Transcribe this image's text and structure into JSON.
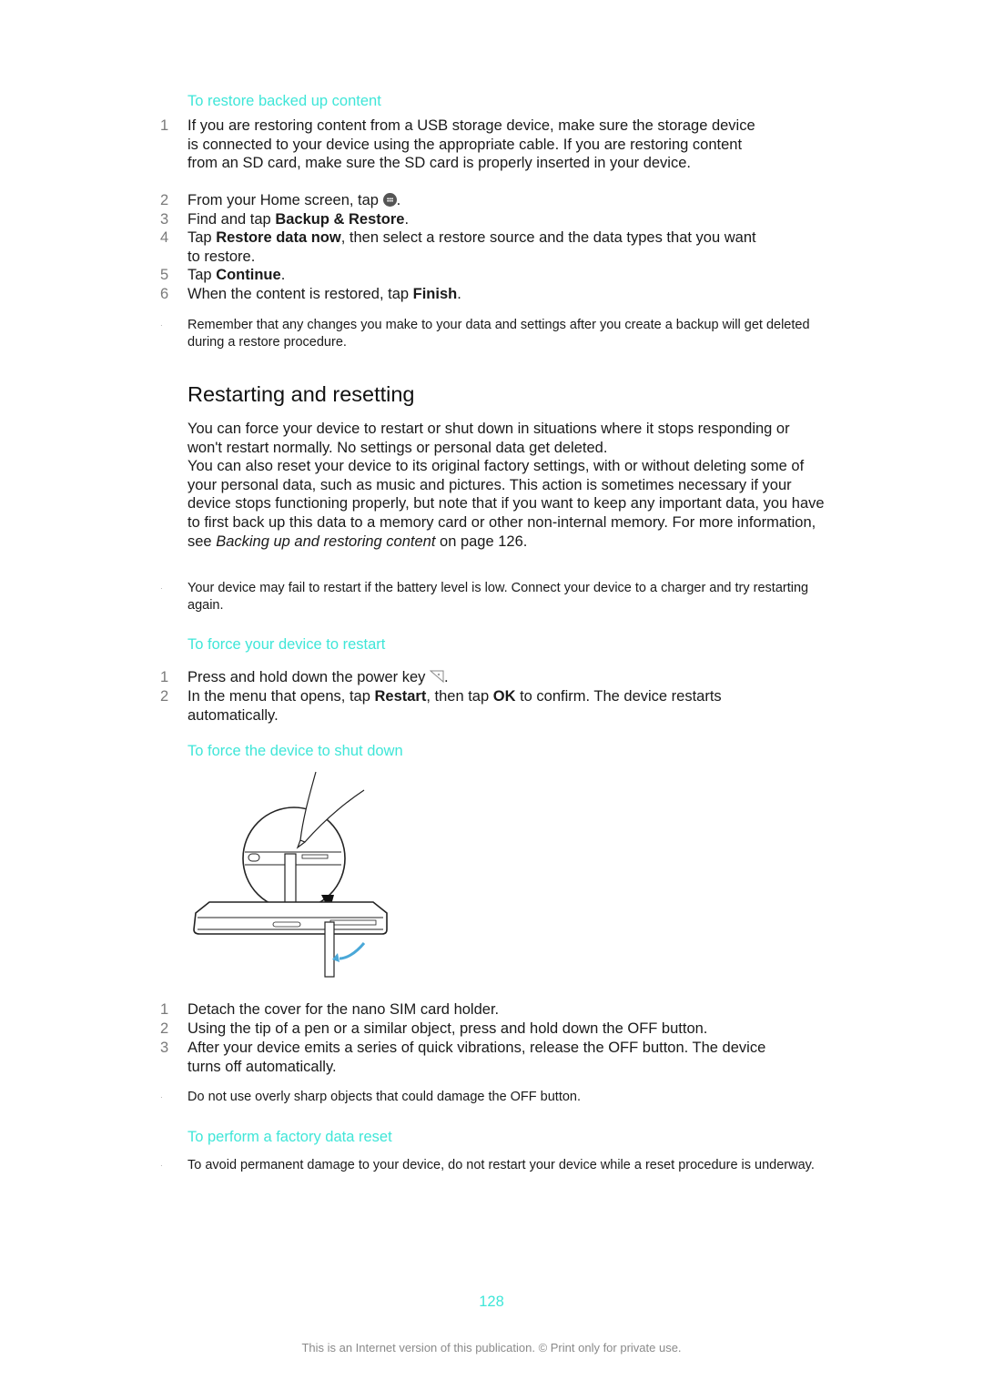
{
  "restore_section": {
    "heading": "To restore backed up content",
    "steps": [
      {
        "num": "1",
        "parts": [
          "If you are restoring content from a USB storage device, make sure the storage device is connected to your device using the appropriate cable. If you are restoring content from an SD card, make sure the SD card is properly inserted in your device."
        ]
      },
      {
        "num": "2",
        "before": "From your Home screen, tap ",
        "icon": "apps-icon",
        "after": "."
      },
      {
        "num": "3",
        "before": "Find and tap ",
        "bold": "Backup & Restore",
        "after": "."
      },
      {
        "num": "4",
        "before": "Tap ",
        "bold": "Restore data now",
        "after": ", then select a restore source and the data types that you want to restore."
      },
      {
        "num": "5",
        "before": "Tap ",
        "bold": "Continue",
        "after": "."
      },
      {
        "num": "6",
        "before": "When the content is restored, tap ",
        "bold": "Finish",
        "after": "."
      }
    ],
    "note": "Remember that any changes you make to your data and settings after you create a backup will get deleted during a restore procedure."
  },
  "restart_section": {
    "title": "Restarting and resetting",
    "para1": "You can force your device to restart or shut down in situations where it stops responding or won't restart normally. No settings or personal data get deleted.",
    "para2_before": "You can also reset your device to its original factory settings, with or without deleting some of your personal data, such as music and pictures. This action is sometimes necessary if your device stops functioning properly, but note that if you want to keep any important data, you have to first back up this data to a memory card or other non-internal memory. For more information, see ",
    "para2_link": "Backing up and restoring content",
    "para2_after": " on page 126.",
    "note": "Your device may fail to restart if the battery level is low. Connect your device to a charger and try restarting again."
  },
  "force_restart": {
    "heading": "To force your device to restart",
    "step1_num": "1",
    "step1_before": "Press and hold down the power key ",
    "step1_icon": "power-key-icon",
    "step1_after": ".",
    "step2_num": "2",
    "step2_before": "In the menu that opens, tap ",
    "step2_bold1": "Restart",
    "step2_mid": ", then tap ",
    "step2_bold2": "OK",
    "step2_after": " to confirm. The device restarts automatically."
  },
  "force_shutdown": {
    "heading": "To force the device to shut down",
    "figure_alt": "Pen tip pressing OFF button under SIM card holder cover",
    "steps": [
      {
        "num": "1",
        "text": "Detach the cover for the nano SIM card holder."
      },
      {
        "num": "2",
        "text": "Using the tip of a pen or a similar object, press and hold down the OFF button."
      },
      {
        "num": "3",
        "text": "After your device emits a series of quick vibrations, release the OFF button. The device turns off automatically."
      }
    ],
    "note": "Do not use overly sharp objects that could damage the OFF button."
  },
  "factory_reset": {
    "heading": "To perform a factory data reset",
    "note": "To avoid permanent damage to your device, do not restart your device while a reset procedure is underway."
  },
  "page_number": "128",
  "footer": "This is an Internet version of this publication. © Print only for private use.",
  "note_marker": "·"
}
